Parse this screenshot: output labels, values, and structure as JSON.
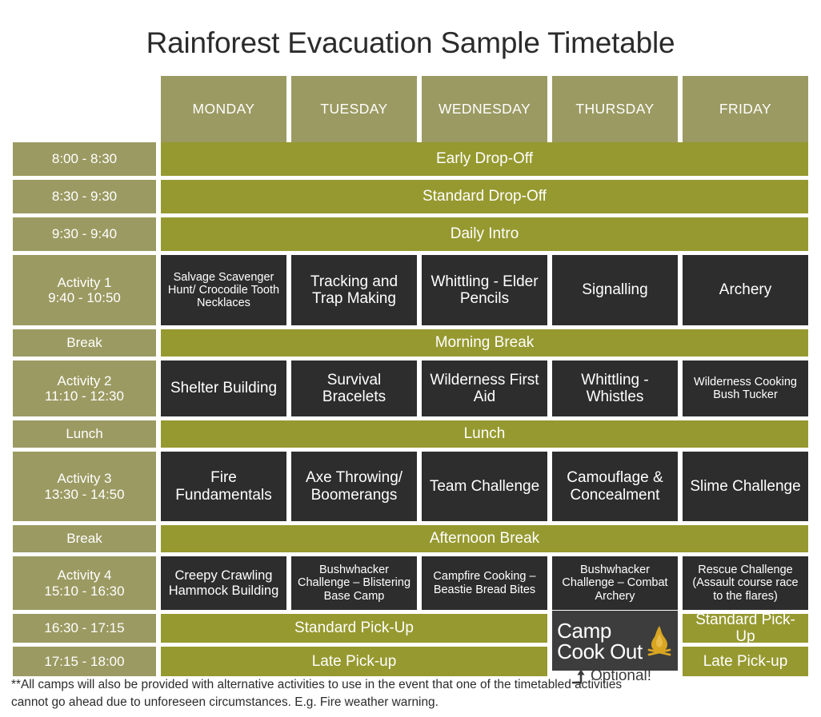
{
  "page": {
    "title": "Rainforest Evacuation Sample Timetable"
  },
  "colors": {
    "olive_header": "#9b9a62",
    "banner_green": "#96992f",
    "activity_dark": "#2d2d2d",
    "logo_tile": "#3d3d3d",
    "flame_gold": "#d9a521",
    "text_light": "#ffffff",
    "text_dark": "#2b2b2b",
    "page_background": "#ffffff"
  },
  "columns": [
    {
      "key": "monday",
      "label": "MONDAY"
    },
    {
      "key": "tuesday",
      "label": "TUESDAY"
    },
    {
      "key": "wednesday",
      "label": "WEDNESDAY"
    },
    {
      "key": "thursday",
      "label": "THURSDAY"
    },
    {
      "key": "friday",
      "label": "FRIDAY"
    }
  ],
  "rows": {
    "early_dropoff": {
      "time": "8:00 - 8:30",
      "banner": "Early Drop-Off"
    },
    "standard_dropoff": {
      "time": "8:30 - 9:30",
      "banner": "Standard Drop-Off"
    },
    "daily_intro": {
      "time": "9:30 - 9:40",
      "banner": "Daily Intro"
    },
    "activity1": {
      "label": "Activity 1",
      "time": "9:40 - 10:50",
      "monday": "Salvage Scavenger Hunt/ Crocodile Tooth Necklaces",
      "tuesday": "Tracking and Trap Making",
      "wednesday": "Whittling - Elder Pencils",
      "thursday": "Signalling",
      "friday": "Archery"
    },
    "morning_break": {
      "time": "Break",
      "banner": "Morning Break"
    },
    "activity2": {
      "label": "Activity 2",
      "time": "11:10 - 12:30",
      "monday": "Shelter Building",
      "tuesday": "Survival Bracelets",
      "wednesday": "Wilderness First Aid",
      "thursday": "Whittling - Whistles",
      "friday": "Wilderness Cooking Bush Tucker"
    },
    "lunch": {
      "time": "Lunch",
      "banner": "Lunch"
    },
    "activity3": {
      "label": "Activity 3",
      "time": "13:30 - 14:50",
      "monday": "Fire Fundamentals",
      "tuesday": "Axe Throwing/ Boomerangs",
      "wednesday": "Team Challenge",
      "thursday": "Camouflage & Concealment",
      "friday": "Slime Challenge"
    },
    "afternoon_break": {
      "time": "Break",
      "banner": "Afternoon Break"
    },
    "activity4": {
      "label": "Activity 4",
      "time": "15:10 - 16:30",
      "monday": "Creepy Crawling Hammock Building",
      "tuesday": "Bushwhacker Challenge – Blistering Base Camp",
      "wednesday": "Campfire Cooking – Beastie Bread Bites",
      "thursday": "Bushwhacker Challenge – Combat Archery",
      "friday": "Rescue Challenge (Assault course race to the flares)"
    },
    "standard_pickup": {
      "time": "16:30 - 17:15",
      "banner": "Standard Pick-Up",
      "friday": "Standard Pick-Up"
    },
    "late_pickup": {
      "time": "17:15 - 18:00",
      "banner": "Late Pick-up",
      "friday": "Late Pick-up"
    }
  },
  "logo": {
    "line1": "Camp",
    "line2": "Cook Out",
    "icon": "campfire-flame-icon"
  },
  "annotation": {
    "arrow_icon": "curved-up-arrow-icon",
    "text": "Optional!"
  },
  "footnote": {
    "text": "**All camps will also be provided with alternative activities to use in the event that one of the timetabled activities cannot go ahead due to unforeseen circumstances. E.g. Fire weather warning."
  }
}
